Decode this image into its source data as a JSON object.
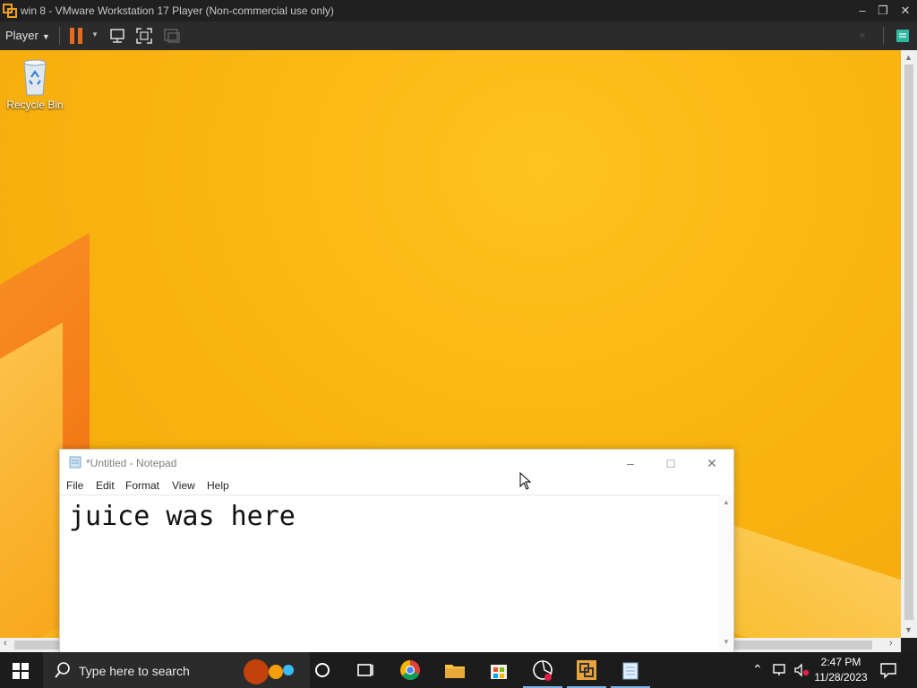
{
  "vmware": {
    "title": "win 8 - VMware Workstation 17 Player (Non-commercial use only)",
    "player_menu": "Player"
  },
  "desktop": {
    "recycle_bin_label": "Recycle Bin"
  },
  "notepad": {
    "title": "*Untitled - Notepad",
    "menu": [
      "File",
      "Edit",
      "Format",
      "View",
      "Help"
    ],
    "content": "juice was here"
  },
  "taskbar": {
    "search_placeholder": "Type here to search",
    "time": "2:47 PM",
    "date": "11/28/2023"
  },
  "colors": {
    "desktop_accent": "#f9b511",
    "vm_pause": "#e86a1c"
  }
}
